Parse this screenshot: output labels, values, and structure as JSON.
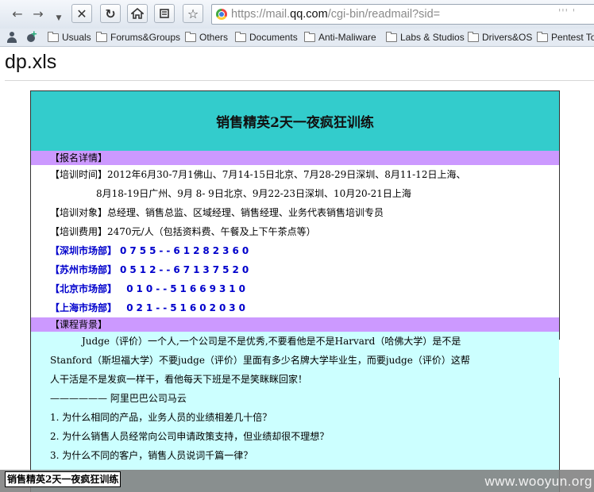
{
  "browser": {
    "url_prefix": "https://mail.",
    "url_domain": "qq.com",
    "url_path": "/cgi-bin/readmail?sid=",
    "url_tail": "''' '"
  },
  "bookmarks": [
    "Usuals",
    "Forums&Groups",
    "Others",
    "Documents",
    "Anti-Maliware",
    "Labs & Studios",
    "Drivers&OS",
    "Pentest To"
  ],
  "page": {
    "title": "dp.xls"
  },
  "doc": {
    "header": "销售精英2天一夜疯狂训练",
    "section_signup": "【报名详情】",
    "training_time_1": "【培训时间】2012年6月30-7月1佛山、7月14-15日北京、7月28-29日深圳、8月11-12日上海、",
    "training_time_2": "8月18-19日广州、9月 8- 9日北京、9月22-23日深圳、10月20-21日上海",
    "training_target": "【培训对象】总经理、销售总监、区域经理、销售经理、业务代表销售培训专员",
    "training_fee": "【培训费用】2470元/人（包括资料费、午餐及上下午茶点等）",
    "contacts": [
      {
        "label": "【深圳市场部】",
        "number": "0755--61282360"
      },
      {
        "label": "【苏州市场部】",
        "number": "0512--67137520"
      },
      {
        "label": "【北京市场部】",
        "number": " 010--51669310"
      },
      {
        "label": "【上海市场部】",
        "number": " 021--51602030"
      }
    ],
    "section_background": "【课程背景】",
    "para_1": "Judge（评价）一个人,一个公司是不是优秀,不要看他是不是Harvard（哈佛大学）是不是",
    "para_2": "Stanford（斯坦福大学）不要judge（评价）里面有多少名牌大学毕业生，而要judge（评价）这帮",
    "para_3": "人干活是不是发疯一样干，看他每天下班是不是笑眯眯回家！",
    "para_4": "—————— 阿里巴巴公司马云",
    "q1": "1. 为什么相同的产品，业务人员的业绩相差几十倍？",
    "q2": "2. 为什么销售人员经常向公司申请政策支持，但业绩却很不理想？",
    "q3": "3. 为什么不同的客户，销售人员说词千篇一律？"
  },
  "sheet_tab": "销售精英2天一夜疯狂训练",
  "watermark": "www.wooyun.org"
}
